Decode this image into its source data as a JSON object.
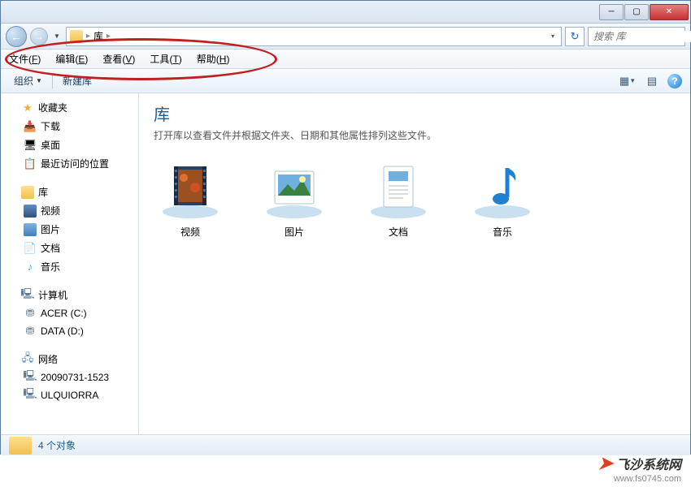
{
  "breadcrumb": {
    "text": "库"
  },
  "search": {
    "placeholder": "搜索 库"
  },
  "menubar": [
    {
      "label": "文件",
      "key": "F"
    },
    {
      "label": "编辑",
      "key": "E"
    },
    {
      "label": "查看",
      "key": "V"
    },
    {
      "label": "工具",
      "key": "T"
    },
    {
      "label": "帮助",
      "key": "H"
    }
  ],
  "toolbar": {
    "organize": "组织",
    "newlib": "新建库"
  },
  "sidebar": {
    "favorites": {
      "label": "收藏夹",
      "items": [
        "下载",
        "桌面",
        "最近访问的位置"
      ]
    },
    "libraries": {
      "label": "库",
      "items": [
        "视频",
        "图片",
        "文档",
        "音乐"
      ]
    },
    "computer": {
      "label": "计算机",
      "items": [
        "ACER (C:)",
        "DATA (D:)"
      ]
    },
    "network": {
      "label": "网络",
      "items": [
        "20090731-1523",
        "ULQUIORRA"
      ]
    }
  },
  "content": {
    "title": "库",
    "subtitle": "打开库以查看文件并根据文件夹、日期和其他属性排列这些文件。",
    "items": [
      "视频",
      "图片",
      "文档",
      "音乐"
    ]
  },
  "statusbar": {
    "text": "4 个对象"
  },
  "watermark": {
    "brand": "飞沙系统网",
    "url": "www.fs0745.com"
  }
}
